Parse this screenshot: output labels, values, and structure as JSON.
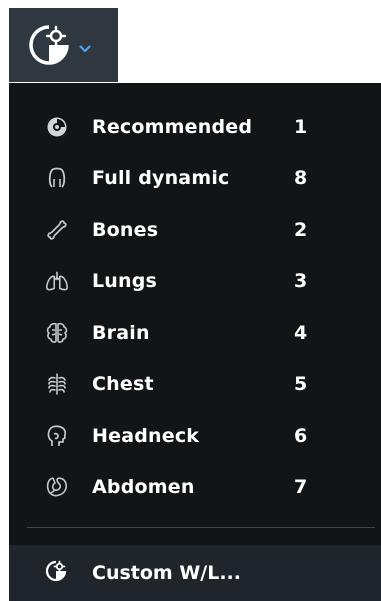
{
  "toolbar": {
    "button_icon": "window-level-icon",
    "dropdown_icon": "chevron-down-icon",
    "accent_color": "#4aa3f0",
    "background_color": "#2f3740"
  },
  "menu": {
    "background_color": "#121518",
    "items": [
      {
        "icon": "recommended-icon",
        "label": "Recommended",
        "shortcut": "1"
      },
      {
        "icon": "full-dynamic-icon",
        "label": "Full dynamic",
        "shortcut": "8"
      },
      {
        "icon": "bone-icon",
        "label": "Bones",
        "shortcut": "2"
      },
      {
        "icon": "lungs-icon",
        "label": "Lungs",
        "shortcut": "3"
      },
      {
        "icon": "brain-icon",
        "label": "Brain",
        "shortcut": "4"
      },
      {
        "icon": "chest-icon",
        "label": "Chest",
        "shortcut": "5"
      },
      {
        "icon": "headneck-icon",
        "label": "Headneck",
        "shortcut": "6"
      },
      {
        "icon": "abdomen-icon",
        "label": "Abdomen",
        "shortcut": "7"
      }
    ],
    "custom": {
      "icon": "custom-window-level-icon",
      "label": "Custom W/L..."
    }
  }
}
